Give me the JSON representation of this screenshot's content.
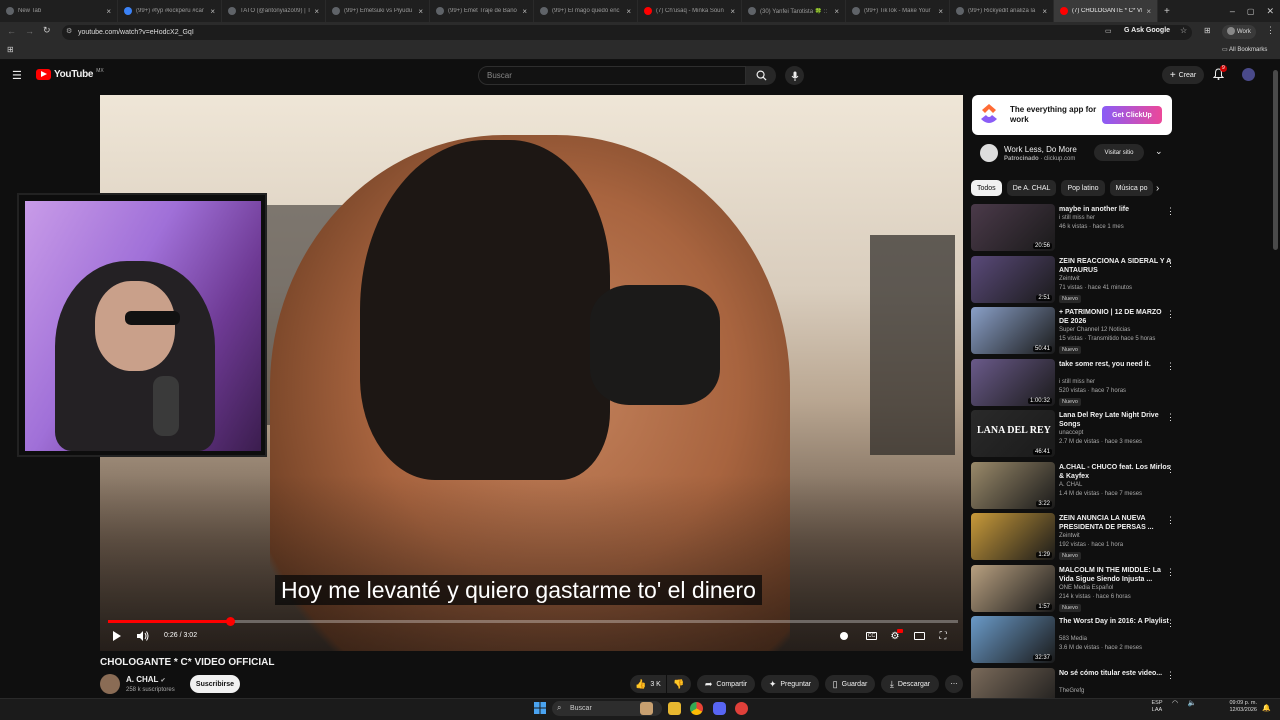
{
  "browser": {
    "tabs": [
      {
        "title": "New Tab",
        "color": "#5f6368"
      },
      {
        "title": "(99+) #fyp #kickperu #car",
        "color": "#3b82f6"
      },
      {
        "title": "TATO (@antonyiazo09) | T",
        "color": "#5f6368"
      },
      {
        "title": "(99+) Emetsuki vs Piyudu",
        "color": "#5f6368"
      },
      {
        "title": "(99+) Emet Traje de Baño",
        "color": "#5f6368"
      },
      {
        "title": "(99+) El mago quedó enc",
        "color": "#5f6368"
      },
      {
        "title": "(7) Ch'usaq - Minka Soun",
        "color": "#ff0000"
      },
      {
        "title": "(30) Yanfei Tarotista 🍀 ::",
        "color": "#5f6368"
      },
      {
        "title": "(99+) TikTok - Make Your",
        "color": "#5f6368"
      },
      {
        "title": "(99+) Rickyedit analiza la",
        "color": "#5f6368"
      },
      {
        "title": "(7) CHOLOGANTE * C* VI",
        "color": "#ff0000",
        "active": true
      }
    ],
    "url": "youtube.com/watch?v=eHodcX2_GqI",
    "ask_google": "Ask Google",
    "profile": "Work",
    "all_bookmarks": "All Bookmarks"
  },
  "youtube": {
    "logo": "YouTube",
    "region": "MX",
    "search_placeholder": "Buscar",
    "create_label": "Crear",
    "notif_count": "9"
  },
  "video": {
    "subtitle": "Hoy me levanté y quiero gastarme to' el dinero",
    "current_time": "0:26",
    "duration": "3:02",
    "time_label": "0:26 / 3:02",
    "progress_fraction": 0.143,
    "title": "CHOLOGANTE * C* VIDEO OFFICIAL",
    "channel": "A. CHAL",
    "subscribers": "258 k suscriptores",
    "subscribe_label": "Suscribirse",
    "likes": "3 K",
    "share_label": "Compartir",
    "ask_label": "Preguntar",
    "save_label": "Guardar",
    "download_label": "Descargar"
  },
  "ad": {
    "headline": "The everything app for work",
    "cta": "Get ClickUp",
    "title": "Work Less, Do More",
    "sponsored": "Patrocinado",
    "domain": "clickup.com",
    "sponsored_line": "Patrocinado · clickup.com",
    "visit_label": "Visitar sitio"
  },
  "chips": [
    {
      "label": "Todos",
      "selected": true
    },
    {
      "label": "De A. CHAL"
    },
    {
      "label": "Pop latino"
    },
    {
      "label": "Música po"
    }
  ],
  "recommendations": [
    {
      "title": "maybe in another life",
      "channel": "i still miss her",
      "meta": "46 k vistas · hace 1 mes",
      "duration": "20:56",
      "new": false,
      "thumb": "#4b3a4a"
    },
    {
      "title": "ZEIN REACCIONA A SIDERAL Y A ANTAURUS",
      "channel": "Zeintwit",
      "meta": "71 vistas · hace 41 minutos",
      "duration": "2:51",
      "new": true,
      "new_label": "Nuevo",
      "thumb": "#5a4a7a"
    },
    {
      "title": "+ PATRIMONIO | 12 DE MARZO DE 2026",
      "channel": "Super Channel 12 Noticias",
      "meta": "15 vistas · Transmitido hace 5 horas",
      "duration": "50:41",
      "new": true,
      "new_label": "Nuevo",
      "thumb": "#8aa0c8"
    },
    {
      "title": "take some rest, you need it.",
      "channel": "i still miss her",
      "meta": "520 vistas · hace 7 horas",
      "duration": "1:00:32",
      "new": true,
      "new_label": "Nuevo",
      "thumb": "#6a5a8a"
    },
    {
      "title": "Lana Del Rey Late Night Drive Songs",
      "channel": "unaccept",
      "meta": "2.7 M de vistas · hace 3 meses",
      "duration": "46:41",
      "new": false,
      "thumb": "#2a2a2a",
      "overlay": "LANA DEL REY"
    },
    {
      "title": "A.CHAL - CHUCO feat. Los Mirlos & Kayfex",
      "channel": "A. CHAL",
      "meta": "1.4 M de vistas · hace 7 meses",
      "duration": "3:22",
      "new": false,
      "thumb": "#9a8a6a"
    },
    {
      "title": "ZEIN ANUNCIA LA NUEVA PRESIDENTA DE PERSAS ...",
      "channel": "Zeintwit",
      "meta": "192 vistas · hace 1 hora",
      "duration": "1:29",
      "new": true,
      "new_label": "Nuevo",
      "thumb": "#c89a3a"
    },
    {
      "title": "MALCOLM IN THE MIDDLE: La Vida Sigue Siendo Injusta ...",
      "channel": "ONE Media Español",
      "meta": "214 k vistas · hace 6 horas",
      "duration": "1:57",
      "new": true,
      "new_label": "Nuevo",
      "thumb": "#b8a080"
    },
    {
      "title": "The Worst Day in 2016: A Playlist",
      "channel": "583 Media",
      "meta": "3.6 M de vistas · hace 2 meses",
      "duration": "32:37",
      "new": false,
      "thumb": "#6a9ac8"
    },
    {
      "title": "No sé cómo titular este video...",
      "channel": "TheGrefg",
      "meta": "",
      "duration": "",
      "new": false,
      "thumb": "#7a6a5a"
    }
  ],
  "taskbar": {
    "search_placeholder": "Buscar",
    "lang": "ESP",
    "lang2": "LAA",
    "time": "09:09 p. m.",
    "date": "12/03/2026"
  }
}
